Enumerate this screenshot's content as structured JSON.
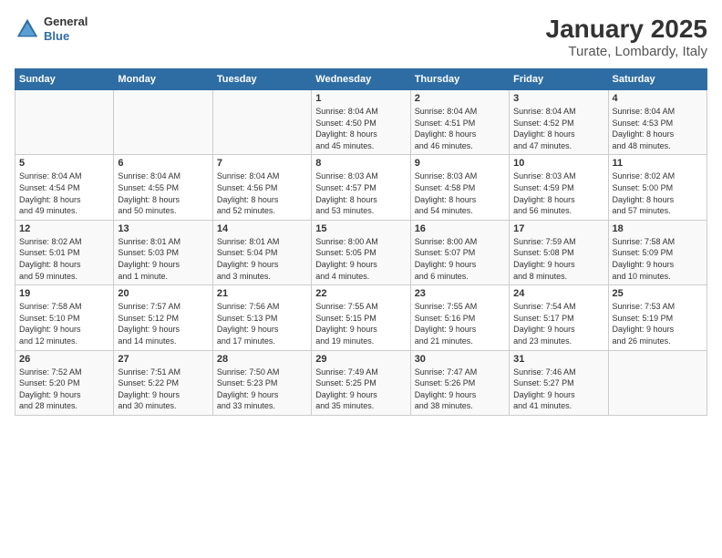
{
  "header": {
    "logo": {
      "general": "General",
      "blue": "Blue"
    },
    "title": "January 2025",
    "subtitle": "Turate, Lombardy, Italy"
  },
  "days_of_week": [
    "Sunday",
    "Monday",
    "Tuesday",
    "Wednesday",
    "Thursday",
    "Friday",
    "Saturday"
  ],
  "weeks": [
    [
      {
        "day": "",
        "info": ""
      },
      {
        "day": "",
        "info": ""
      },
      {
        "day": "",
        "info": ""
      },
      {
        "day": "1",
        "info": "Sunrise: 8:04 AM\nSunset: 4:50 PM\nDaylight: 8 hours\nand 45 minutes."
      },
      {
        "day": "2",
        "info": "Sunrise: 8:04 AM\nSunset: 4:51 PM\nDaylight: 8 hours\nand 46 minutes."
      },
      {
        "day": "3",
        "info": "Sunrise: 8:04 AM\nSunset: 4:52 PM\nDaylight: 8 hours\nand 47 minutes."
      },
      {
        "day": "4",
        "info": "Sunrise: 8:04 AM\nSunset: 4:53 PM\nDaylight: 8 hours\nand 48 minutes."
      }
    ],
    [
      {
        "day": "5",
        "info": "Sunrise: 8:04 AM\nSunset: 4:54 PM\nDaylight: 8 hours\nand 49 minutes."
      },
      {
        "day": "6",
        "info": "Sunrise: 8:04 AM\nSunset: 4:55 PM\nDaylight: 8 hours\nand 50 minutes."
      },
      {
        "day": "7",
        "info": "Sunrise: 8:04 AM\nSunset: 4:56 PM\nDaylight: 8 hours\nand 52 minutes."
      },
      {
        "day": "8",
        "info": "Sunrise: 8:03 AM\nSunset: 4:57 PM\nDaylight: 8 hours\nand 53 minutes."
      },
      {
        "day": "9",
        "info": "Sunrise: 8:03 AM\nSunset: 4:58 PM\nDaylight: 8 hours\nand 54 minutes."
      },
      {
        "day": "10",
        "info": "Sunrise: 8:03 AM\nSunset: 4:59 PM\nDaylight: 8 hours\nand 56 minutes."
      },
      {
        "day": "11",
        "info": "Sunrise: 8:02 AM\nSunset: 5:00 PM\nDaylight: 8 hours\nand 57 minutes."
      }
    ],
    [
      {
        "day": "12",
        "info": "Sunrise: 8:02 AM\nSunset: 5:01 PM\nDaylight: 8 hours\nand 59 minutes."
      },
      {
        "day": "13",
        "info": "Sunrise: 8:01 AM\nSunset: 5:03 PM\nDaylight: 9 hours\nand 1 minute."
      },
      {
        "day": "14",
        "info": "Sunrise: 8:01 AM\nSunset: 5:04 PM\nDaylight: 9 hours\nand 3 minutes."
      },
      {
        "day": "15",
        "info": "Sunrise: 8:00 AM\nSunset: 5:05 PM\nDaylight: 9 hours\nand 4 minutes."
      },
      {
        "day": "16",
        "info": "Sunrise: 8:00 AM\nSunset: 5:07 PM\nDaylight: 9 hours\nand 6 minutes."
      },
      {
        "day": "17",
        "info": "Sunrise: 7:59 AM\nSunset: 5:08 PM\nDaylight: 9 hours\nand 8 minutes."
      },
      {
        "day": "18",
        "info": "Sunrise: 7:58 AM\nSunset: 5:09 PM\nDaylight: 9 hours\nand 10 minutes."
      }
    ],
    [
      {
        "day": "19",
        "info": "Sunrise: 7:58 AM\nSunset: 5:10 PM\nDaylight: 9 hours\nand 12 minutes."
      },
      {
        "day": "20",
        "info": "Sunrise: 7:57 AM\nSunset: 5:12 PM\nDaylight: 9 hours\nand 14 minutes."
      },
      {
        "day": "21",
        "info": "Sunrise: 7:56 AM\nSunset: 5:13 PM\nDaylight: 9 hours\nand 17 minutes."
      },
      {
        "day": "22",
        "info": "Sunrise: 7:55 AM\nSunset: 5:15 PM\nDaylight: 9 hours\nand 19 minutes."
      },
      {
        "day": "23",
        "info": "Sunrise: 7:55 AM\nSunset: 5:16 PM\nDaylight: 9 hours\nand 21 minutes."
      },
      {
        "day": "24",
        "info": "Sunrise: 7:54 AM\nSunset: 5:17 PM\nDaylight: 9 hours\nand 23 minutes."
      },
      {
        "day": "25",
        "info": "Sunrise: 7:53 AM\nSunset: 5:19 PM\nDaylight: 9 hours\nand 26 minutes."
      }
    ],
    [
      {
        "day": "26",
        "info": "Sunrise: 7:52 AM\nSunset: 5:20 PM\nDaylight: 9 hours\nand 28 minutes."
      },
      {
        "day": "27",
        "info": "Sunrise: 7:51 AM\nSunset: 5:22 PM\nDaylight: 9 hours\nand 30 minutes."
      },
      {
        "day": "28",
        "info": "Sunrise: 7:50 AM\nSunset: 5:23 PM\nDaylight: 9 hours\nand 33 minutes."
      },
      {
        "day": "29",
        "info": "Sunrise: 7:49 AM\nSunset: 5:25 PM\nDaylight: 9 hours\nand 35 minutes."
      },
      {
        "day": "30",
        "info": "Sunrise: 7:47 AM\nSunset: 5:26 PM\nDaylight: 9 hours\nand 38 minutes."
      },
      {
        "day": "31",
        "info": "Sunrise: 7:46 AM\nSunset: 5:27 PM\nDaylight: 9 hours\nand 41 minutes."
      },
      {
        "day": "",
        "info": ""
      }
    ]
  ]
}
